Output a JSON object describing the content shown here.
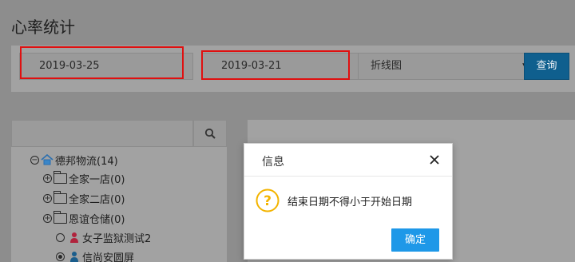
{
  "page": {
    "title": "心率统计"
  },
  "filters": {
    "start_date": "2019-03-25",
    "end_date": "2019-03-21",
    "chart_type": "折线图",
    "query_label": "查询"
  },
  "tree": {
    "root": "德邦物流(14)",
    "stores": [
      "全家一店(0)",
      "全家二店(0)",
      "恩谊仓储(0)"
    ],
    "devices": [
      {
        "label": "女子监狱测试2",
        "checked": false,
        "icon_color": "#b0233c"
      },
      {
        "label": "信尚安圆屏",
        "checked": true,
        "icon_color": "#1a5d8c"
      }
    ]
  },
  "dialog": {
    "title": "信息",
    "message": "结束日期不得小于开始日期",
    "confirm_label": "确定"
  },
  "colors": {
    "highlight": "#e01010",
    "primary_button": "#1e98e8",
    "warning_icon": "#f3b400"
  }
}
